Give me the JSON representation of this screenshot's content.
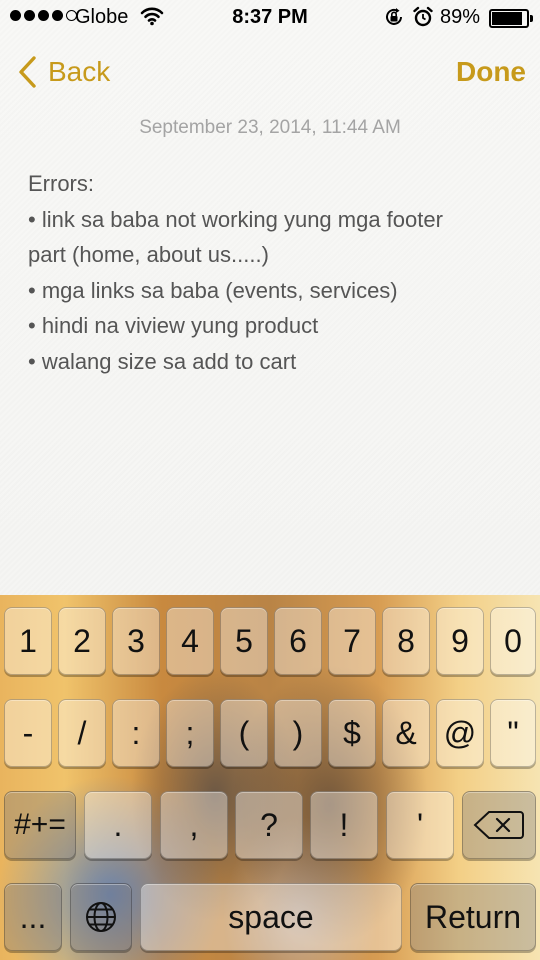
{
  "status_bar": {
    "carrier": "Globe",
    "time": "8:37 PM",
    "battery_percent": "89%",
    "battery_level": 0.89,
    "signal_bars_filled": 4,
    "signal_bars_total": 5
  },
  "nav": {
    "back_label": "Back",
    "done_label": "Done"
  },
  "note": {
    "date": "September 23, 2014, 11:44 AM",
    "lines": [
      "Errors:",
      "• link sa baba not working yung mga footer",
      "part (home, about us.....)",
      "• mga links sa baba (events, services)",
      "• hindi na viview yung product",
      "• walang size sa add to cart"
    ]
  },
  "keyboard": {
    "row1": [
      "1",
      "2",
      "3",
      "4",
      "5",
      "6",
      "7",
      "8",
      "9",
      "0"
    ],
    "row2": [
      "-",
      "/",
      ":",
      ";",
      "(",
      ")",
      "$",
      "&",
      "@",
      "\""
    ],
    "row3": {
      "toggle": "#+=",
      "keys": [
        ".",
        ",",
        "?",
        "!",
        "'"
      ]
    },
    "row4": {
      "more": "...",
      "space": "space",
      "return": "Return"
    }
  },
  "colors": {
    "accent": "#c79a1b",
    "note_text": "#555555",
    "date_text": "#a4a4a4"
  },
  "icons": [
    "wifi-icon",
    "rotation-lock-icon",
    "alarm-icon",
    "battery-icon",
    "chevron-left-icon",
    "globe-icon",
    "delete-icon"
  ]
}
